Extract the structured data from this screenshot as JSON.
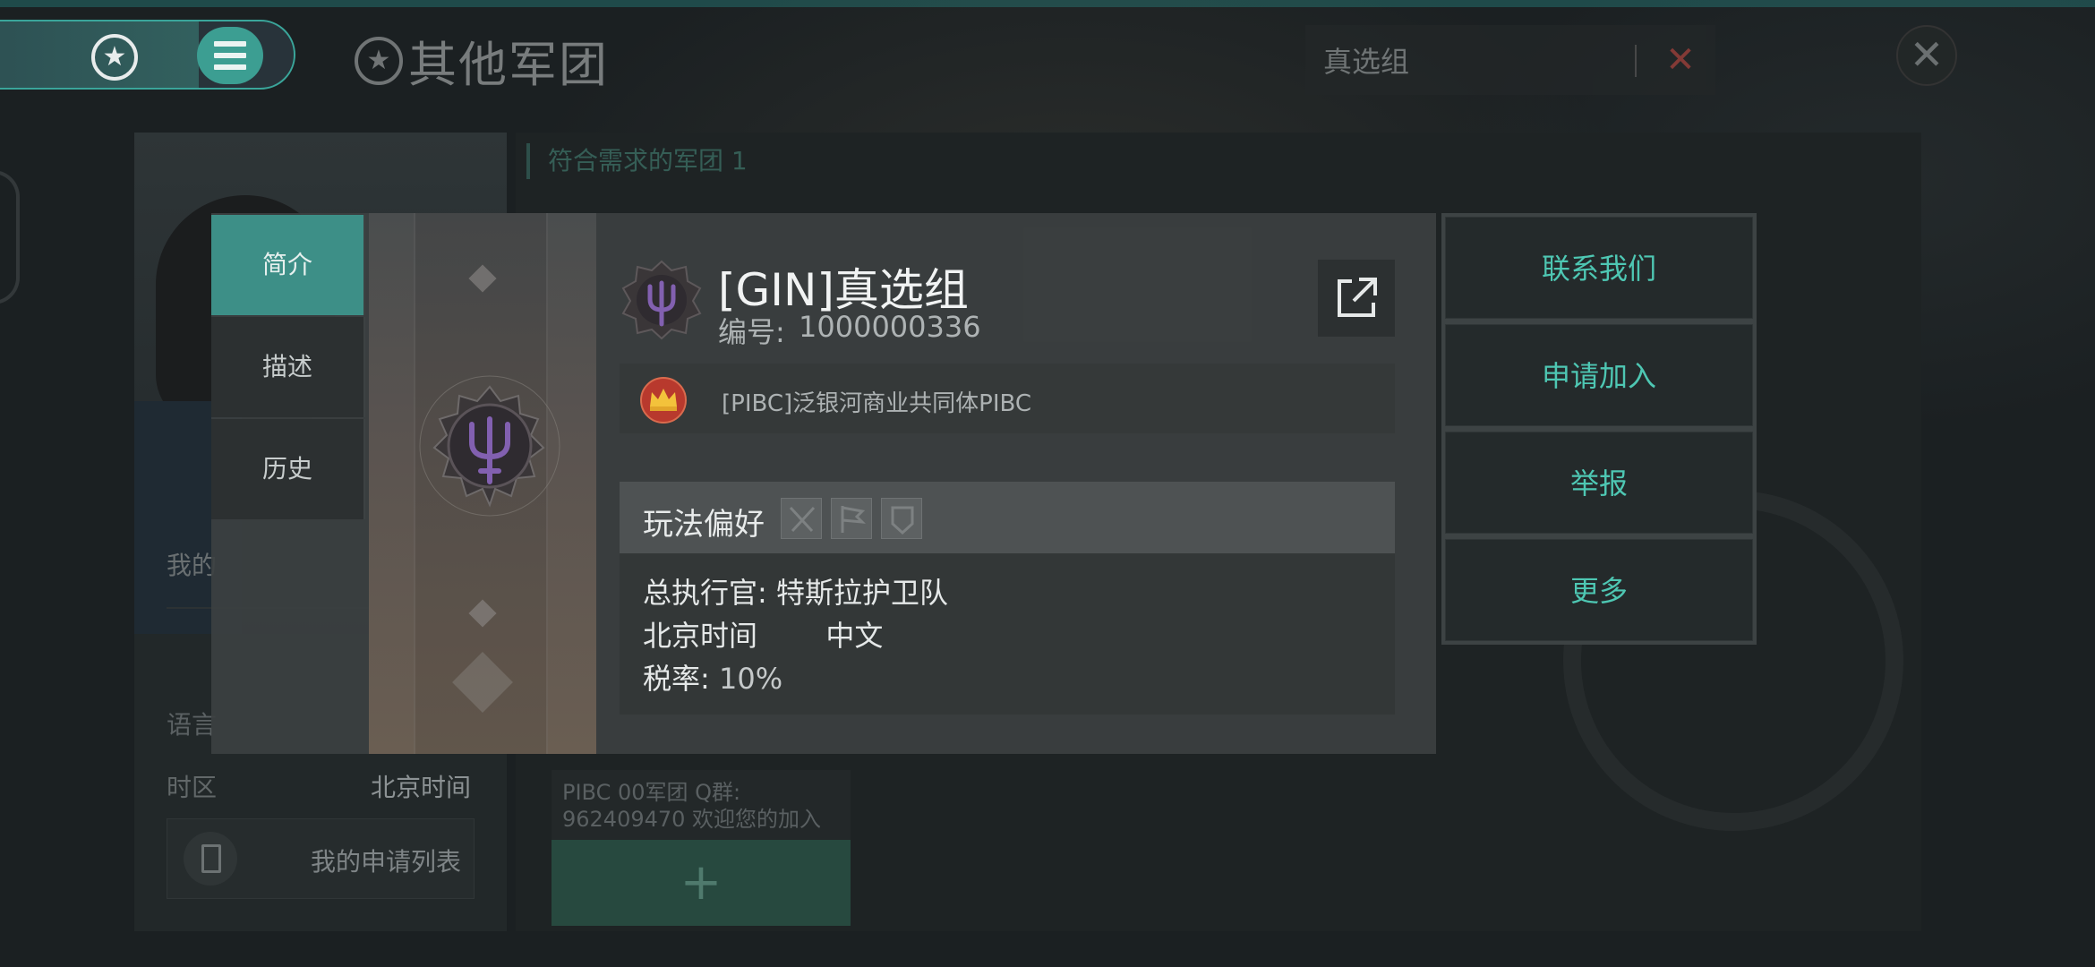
{
  "header": {
    "title": "其他军团",
    "search": {
      "value": "真选组",
      "placeholder": ""
    }
  },
  "profile": {
    "my_label": "我的",
    "language_label": "语言",
    "timezone_label": "时区",
    "timezone_value": "北京时间",
    "apply_list_label": "我的申请列表"
  },
  "results": {
    "header": "符合需求的军团 1",
    "card_description": "PIBC 00军团 Q群: 962409470 欢迎您的加入"
  },
  "dialog": {
    "tabs": [
      {
        "label": "简介",
        "active": true
      },
      {
        "label": "描述",
        "active": false
      },
      {
        "label": "历史",
        "active": false
      }
    ],
    "corp_name": "[GIN]真选组",
    "corp_id_label": "编号:",
    "corp_id": "1000000336",
    "alliance_name": "[PIBC]泛银河商业共同体PIBC",
    "play_pref_label": "玩法偏好",
    "ceo_label": "总执行官:",
    "ceo_name": "特斯拉护卫队",
    "timezone": "北京时间",
    "language": "中文",
    "tax_label": "税率:",
    "tax_value": "10%"
  },
  "actions": {
    "contact": "联系我们",
    "apply": "申请加入",
    "report": "举报",
    "more": "更多"
  },
  "colors": {
    "accent": "#3d8f87",
    "action_text": "#4ec7b3",
    "emblem": "#7f60a8"
  }
}
